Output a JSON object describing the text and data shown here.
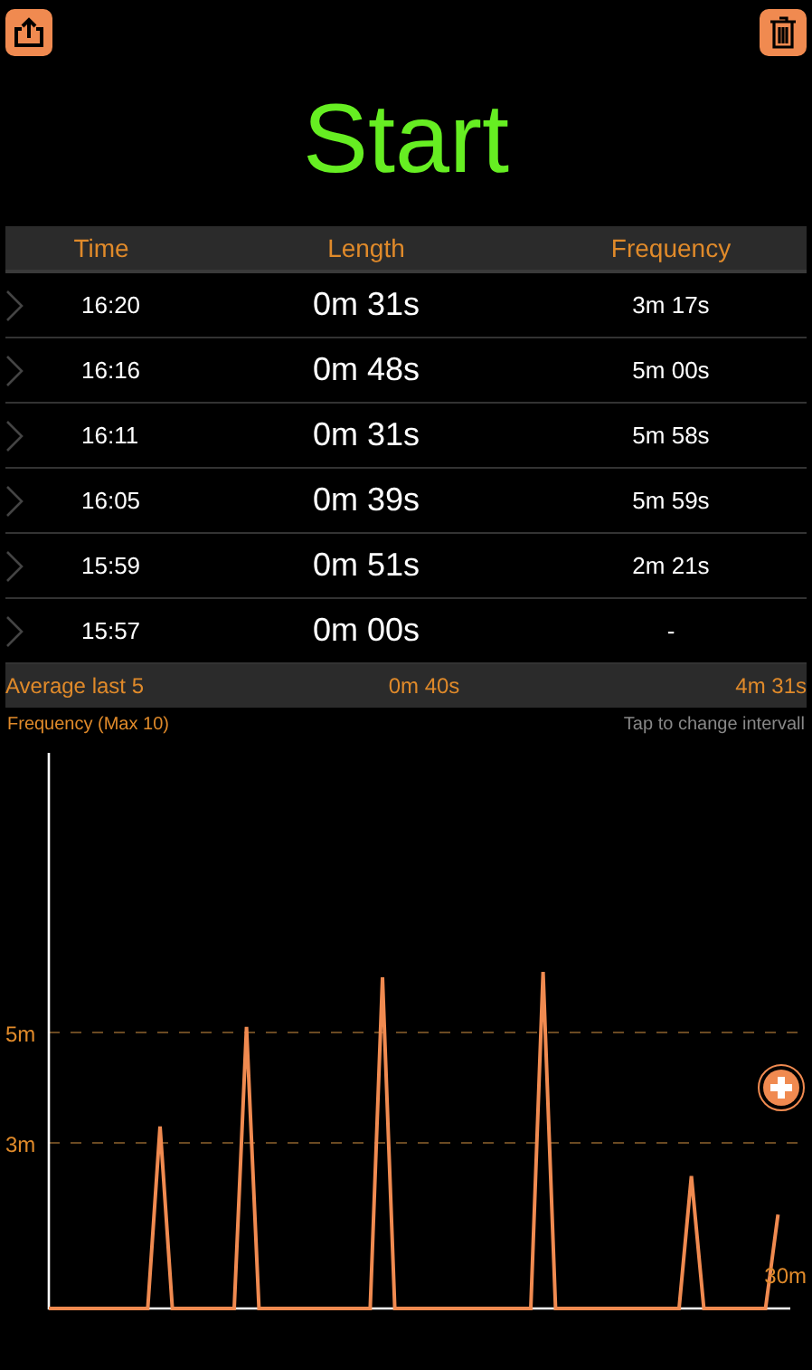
{
  "title": "Start",
  "table": {
    "columns": [
      "Time",
      "Length",
      "Frequency"
    ],
    "rows": [
      {
        "time": "16:20",
        "length": "0m 31s",
        "frequency": "3m 17s"
      },
      {
        "time": "16:16",
        "length": "0m 48s",
        "frequency": "5m 00s"
      },
      {
        "time": "16:11",
        "length": "0m 31s",
        "frequency": "5m 58s"
      },
      {
        "time": "16:05",
        "length": "0m 39s",
        "frequency": "5m 59s"
      },
      {
        "time": "15:59",
        "length": "0m 51s",
        "frequency": "2m 21s"
      },
      {
        "time": "15:57",
        "length": "0m 00s",
        "frequency": "-"
      }
    ]
  },
  "average": {
    "label": "Average last 5",
    "length": "0m 40s",
    "frequency": "4m 31s"
  },
  "chart": {
    "label": "Frequency (Max 10)",
    "hint": "Tap to change intervall",
    "chart_data": {
      "type": "line",
      "ylim": [
        0,
        10
      ],
      "yticks": [
        {
          "value": 3,
          "label": "3m"
        },
        {
          "value": 5,
          "label": "5m"
        }
      ],
      "annotations": [
        {
          "text": "30m"
        }
      ],
      "series": [
        {
          "color": "#f08a50",
          "values": [
            0,
            0,
            0,
            0,
            0,
            0,
            0,
            0,
            0,
            3.3,
            0,
            0,
            0,
            0,
            0,
            0,
            5.1,
            0,
            0,
            0,
            0,
            0,
            0,
            0,
            0,
            0,
            0,
            6.0,
            0,
            0,
            0,
            0,
            0,
            0,
            0,
            0,
            0,
            0,
            0,
            0,
            6.1,
            0,
            0,
            0,
            0,
            0,
            0,
            0,
            0,
            0,
            0,
            0,
            2.4,
            0,
            0,
            0,
            0,
            0,
            0,
            1.7,
            null
          ]
        }
      ]
    }
  }
}
